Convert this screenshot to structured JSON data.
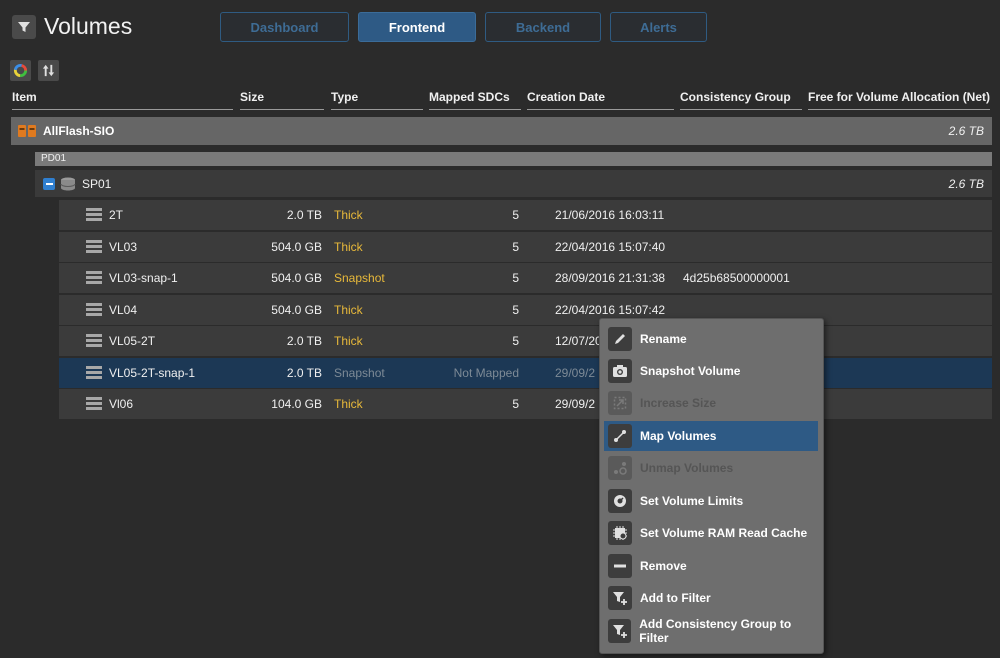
{
  "header": {
    "title": "Volumes",
    "tabs": [
      {
        "label": "Dashboard",
        "active": false
      },
      {
        "label": "Frontend",
        "active": true
      },
      {
        "label": "Backend",
        "active": false
      },
      {
        "label": "Alerts",
        "active": false
      }
    ]
  },
  "toolbar": {
    "icons": [
      "refresh-icon",
      "sort-icon"
    ]
  },
  "columns": {
    "item": "Item",
    "size": "Size",
    "type": "Type",
    "mapped_sdcs": "Mapped SDCs",
    "creation_date": "Creation Date",
    "consistency_group": "Consistency Group",
    "free": "Free for Volume Allocation (Net)"
  },
  "system": {
    "name": "AllFlash-SIO",
    "free": "2.6 TB"
  },
  "protection_domain": {
    "name": "PD01"
  },
  "storage_pool": {
    "name": "SP01",
    "free": "2.6 TB"
  },
  "volumes": [
    {
      "name": "2T",
      "size": "2.0 TB",
      "type": "Thick",
      "sdcs": "5",
      "date": "21/06/2016 16:03:11",
      "cg": ""
    },
    {
      "name": "VL03",
      "size": "504.0 GB",
      "type": "Thick",
      "sdcs": "5",
      "date": "22/04/2016 15:07:40",
      "cg": ""
    },
    {
      "name": "VL03-snap-1",
      "size": "504.0 GB",
      "type": "Snapshot",
      "sdcs": "5",
      "date": "28/09/2016 21:31:38",
      "cg": "4d25b68500000001"
    },
    {
      "name": "VL04",
      "size": "504.0 GB",
      "type": "Thick",
      "sdcs": "5",
      "date": "22/04/2016 15:07:42",
      "cg": ""
    },
    {
      "name": "VL05-2T",
      "size": "2.0 TB",
      "type": "Thick",
      "sdcs": "5",
      "date": "12/07/20",
      "cg": ""
    },
    {
      "name": "VL05-2T-snap-1",
      "size": "2.0 TB",
      "type": "Snapshot",
      "sdcs": "Not Mapped",
      "date": "29/09/2",
      "cg": ""
    },
    {
      "name": "Vl06",
      "size": "104.0 GB",
      "type": "Thick",
      "sdcs": "5",
      "date": "29/09/2",
      "cg": ""
    }
  ],
  "selected_volume_index": 5,
  "context_menu": {
    "items": [
      {
        "label": "Rename",
        "icon": "pencil-icon",
        "enabled": true
      },
      {
        "label": "Snapshot Volume",
        "icon": "camera-icon",
        "enabled": true
      },
      {
        "label": "Increase Size",
        "icon": "expand-icon",
        "enabled": false
      },
      {
        "label": "Map Volumes",
        "icon": "map-icon",
        "enabled": true,
        "highlighted": true
      },
      {
        "label": "Unmap Volumes",
        "icon": "unmap-icon",
        "enabled": false
      },
      {
        "label": "Set Volume Limits",
        "icon": "gauge-icon",
        "enabled": true
      },
      {
        "label": "Set Volume RAM Read Cache",
        "icon": "chip-icon",
        "enabled": true
      },
      {
        "label": "Remove",
        "icon": "minus-icon",
        "enabled": true
      },
      {
        "label": "Add to Filter",
        "icon": "filter-add-icon",
        "enabled": true
      },
      {
        "label": "Add Consistency Group to Filter",
        "icon": "filter-add-icon",
        "enabled": true
      }
    ]
  }
}
